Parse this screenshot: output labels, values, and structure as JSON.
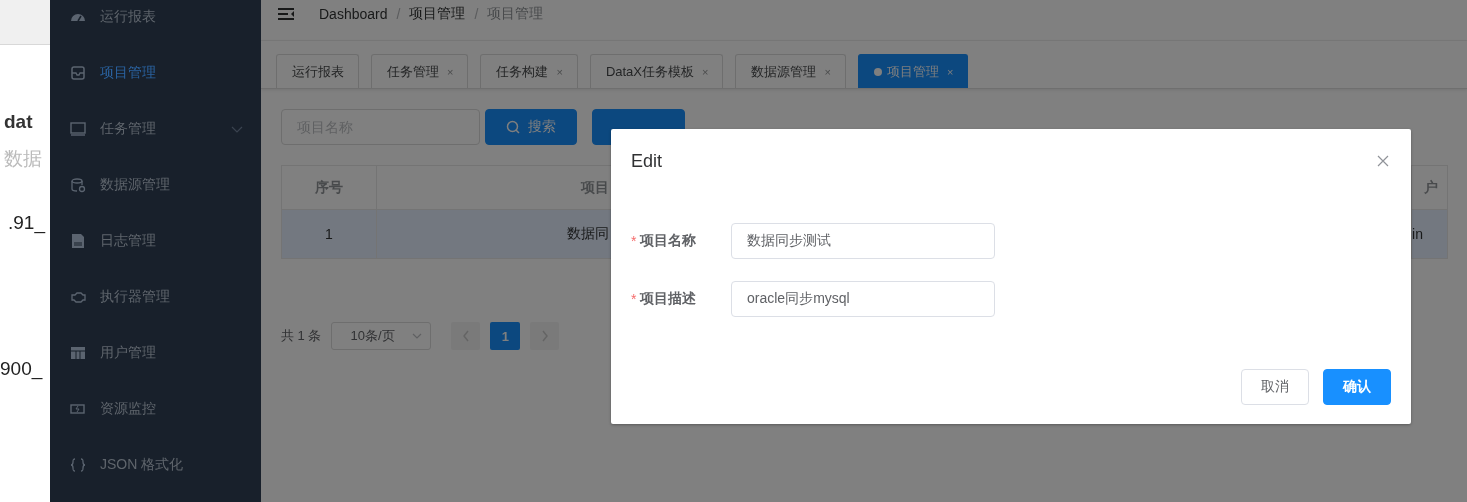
{
  "background_window": {
    "texts": [
      {
        "text": "dat",
        "kind": "bold"
      },
      {
        "text": "数据",
        "kind": "muted"
      },
      {
        "text": ".91_",
        "kind": "plain"
      },
      {
        "text": "900_",
        "kind": "plain"
      }
    ]
  },
  "sidebar": {
    "items": [
      {
        "label": "运行报表",
        "selected": false,
        "expandable": false
      },
      {
        "label": "项目管理",
        "selected": true,
        "expandable": false
      },
      {
        "label": "任务管理",
        "selected": false,
        "expandable": true
      },
      {
        "label": "数据源管理",
        "selected": false,
        "expandable": false
      },
      {
        "label": "日志管理",
        "selected": false,
        "expandable": false
      },
      {
        "label": "执行器管理",
        "selected": false,
        "expandable": false
      },
      {
        "label": "用户管理",
        "selected": false,
        "expandable": false
      },
      {
        "label": "资源监控",
        "selected": false,
        "expandable": false
      },
      {
        "label": "JSON 格式化",
        "selected": false,
        "expandable": false
      }
    ]
  },
  "header": {
    "separator": "/",
    "breadcrumb": [
      {
        "label": "Dashboard",
        "current": false
      },
      {
        "label": "项目管理",
        "current": false
      },
      {
        "label": "项目管理",
        "current": true
      }
    ]
  },
  "tabs": [
    {
      "label": "运行报表",
      "selected": false
    },
    {
      "label": "任务管理",
      "close": "×",
      "selected": false
    },
    {
      "label": "任务构建",
      "close": "×",
      "selected": false
    },
    {
      "label": "DataX任务模板",
      "close": "×",
      "selected": false
    },
    {
      "label": "数据源管理",
      "close": "×",
      "selected": false
    },
    {
      "label": "项目管理",
      "close": "×",
      "selected": true
    }
  ],
  "toolbar": {
    "search_field": {
      "placeholder": "项目名称"
    },
    "search_button": "搜索"
  },
  "table": {
    "columns": [
      "序号",
      "项目",
      "户"
    ],
    "rows": [
      {
        "cells": [
          "1",
          "数据同",
          "in"
        ],
        "selected": true
      }
    ]
  },
  "pagination": {
    "total": "共 1 条",
    "page_size": "10条/页",
    "pages": [
      {
        "label": "1",
        "selected": true
      }
    ]
  },
  "dialog": {
    "title": "Edit",
    "fields": [
      {
        "mark": "*",
        "label": "项目名称",
        "value": "数据同步测试"
      },
      {
        "mark": "*",
        "label": "项目描述",
        "value": "oracle同步mysql"
      }
    ],
    "buttons": [
      {
        "label": "取消",
        "kind": "default"
      },
      {
        "label": "确认",
        "kind": "primary"
      }
    ]
  }
}
